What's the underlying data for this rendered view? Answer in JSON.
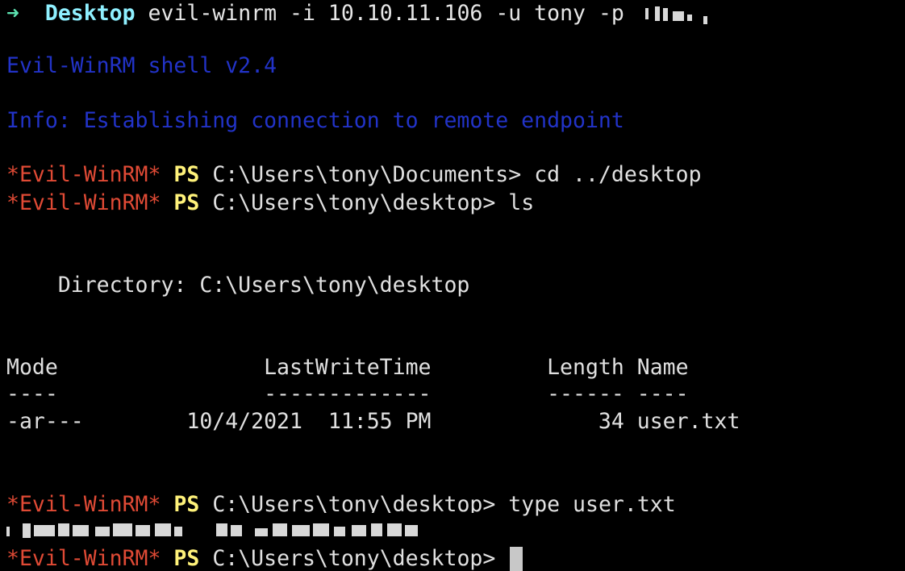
{
  "prompt_line": {
    "arrow": "➜",
    "dir": "Desktop",
    "command": "evil-winrm -i 10.10.11.106 -u tony -p"
  },
  "banner": "Evil-WinRM shell v2.4",
  "info": "Info: Establishing connection to remote endpoint",
  "ps_prompt": {
    "tag": "*Evil-WinRM*",
    "ps": "PS"
  },
  "commands": [
    {
      "path": "C:\\Users\\tony\\Documents>",
      "input": "cd ../desktop"
    },
    {
      "path": "C:\\Users\\tony\\desktop>",
      "input": "ls"
    },
    {
      "path": "C:\\Users\\tony\\desktop>",
      "input": "type user.txt"
    },
    {
      "path": "C:\\Users\\tony\\desktop>",
      "input": ""
    }
  ],
  "directory_line": "    Directory: C:\\Users\\tony\\desktop",
  "table": {
    "header": "Mode                LastWriteTime         Length Name",
    "separator": "----                -------------         ------ ----",
    "rows": [
      "-ar---        10/4/2021  11:55 PM             34 user.txt"
    ]
  },
  "colors": {
    "background": "#000000",
    "arrow": "#5ce1b0",
    "dir": "#8ff0ff",
    "banner_blue": "#2233c8",
    "prompt_red": "#e04a35",
    "ps_yellow": "#fff27a"
  }
}
